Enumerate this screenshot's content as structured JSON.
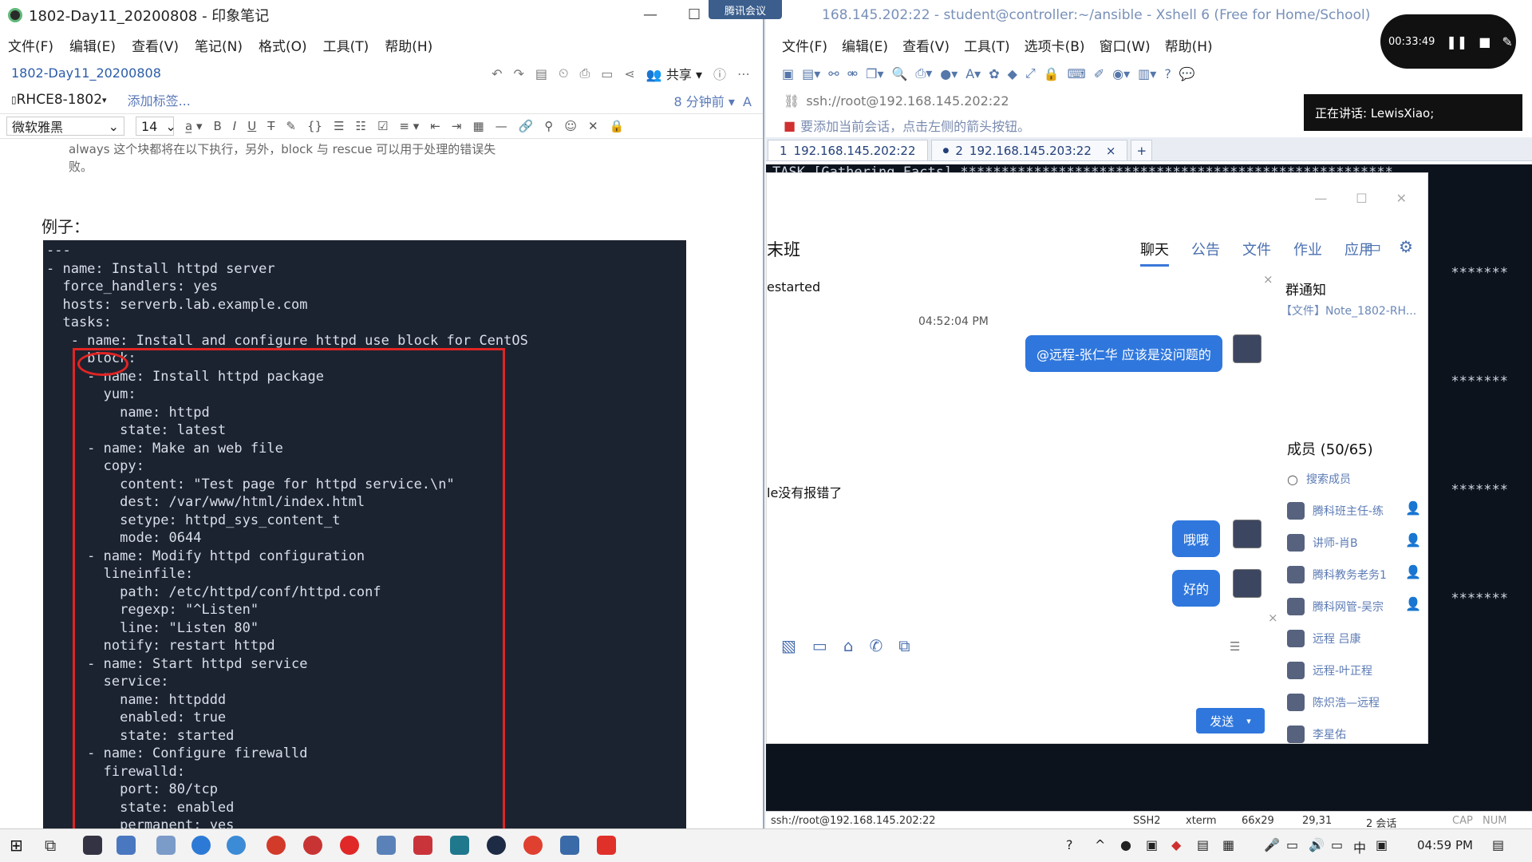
{
  "evernote": {
    "title": "1802-Day11_20200808 - 印象笔记",
    "menu": [
      "文件(F)",
      "编辑(E)",
      "查看(V)",
      "笔记(N)",
      "格式(O)",
      "工具(T)",
      "帮助(H)"
    ],
    "note_title": "1802-Day11_20200808",
    "share_label": "共享",
    "notebook": "RHCE8-1802",
    "add_tag": "添加标签...",
    "updated": "8 分钟前",
    "font_name": "微软雅黑",
    "font_size": "14",
    "prev_text_line1": "always 这个块都将在以下执行，另外，block 与 rescue 可以用于处理的错误失",
    "prev_text_line2": "败。",
    "example_label": "例子：",
    "code_lines": [
      "---",
      "- name: Install httpd server",
      "  force_handlers: yes",
      "  hosts: serverb.lab.example.com",
      "  tasks:",
      "   - name: Install and configure httpd use block for CentOS",
      "     block:",
      "     - name: Install httpd package",
      "       yum:",
      "         name: httpd",
      "         state: latest",
      "     - name: Make an web file",
      "       copy:",
      "         content: \"Test page for httpd service.\\n\"",
      "         dest: /var/www/html/index.html",
      "         setype: httpd_sys_content_t",
      "         mode: 0644",
      "     - name: Modify httpd configuration",
      "       lineinfile:",
      "         path: /etc/httpd/conf/httpd.conf",
      "         regexp: \"^Listen\"",
      "         line: \"Listen 80\"",
      "       notify: restart httpd",
      "     - name: Start httpd service",
      "       service:",
      "         name: httpddd",
      "         enabled: true",
      "         state: started",
      "     - name: Configure firewalld",
      "       firewalld:",
      "         port: 80/tcp",
      "         state: enabled",
      "         permanent: yes"
    ]
  },
  "xshell": {
    "title": "168.145.202:22 - student@controller:~/ansible - Xshell 6 (Free for Home/School)",
    "menu": [
      "文件(F)",
      "编辑(E)",
      "查看(V)",
      "工具(T)",
      "选项卡(B)",
      "窗口(W)",
      "帮助(H)"
    ],
    "address": "ssh://root@192.168.145.202:22",
    "hint": "要添加当前会话，点击左侧的箭头按钮。",
    "tabs": [
      {
        "num": "1",
        "label": "192.168.145.202:22"
      },
      {
        "num": "2",
        "label": "192.168.145.203:22"
      }
    ],
    "terminal_first_line": "TASK [Gathering Facts] *****************************************************",
    "star_fragment": "*******",
    "status": {
      "conn": "ssh://root@192.168.145.202:22",
      "proto": "SSH2",
      "term": "xterm",
      "size": "66x29",
      "pos": "29,31",
      "sessions": "2 会话",
      "caps": "CAP",
      "num": "NUM"
    }
  },
  "recording": {
    "time": "00:33:49",
    "speaking": "正在讲话: LewisXiao;",
    "meeting_tag": "腾讯会议"
  },
  "chat": {
    "title": "末班",
    "tabs": [
      "聊天",
      "公告",
      "文件",
      "作业",
      "应用"
    ],
    "msg_started": "estarted",
    "time1": "04:52:04 PM",
    "bubble1": "@远程-张仁华 应该是没问题的",
    "msg_no_error": "le没有报错了",
    "bubble2": "哦哦",
    "bubble3": "好的",
    "notice_title": "群通知",
    "notice_file": "【文件】Note_1802-RH...",
    "members_title": "成员 (50/65)",
    "search_members": "搜索成员",
    "members": [
      "腾科班主任-练",
      "讲师-肖B",
      "腾科教务老务1",
      "腾科网管-吴宗",
      "远程 吕康",
      "远程-叶正程",
      "陈炽浩—远程",
      "李星佑"
    ],
    "send_label": "发送"
  },
  "taskbar": {
    "clock": "04:59 PM"
  }
}
